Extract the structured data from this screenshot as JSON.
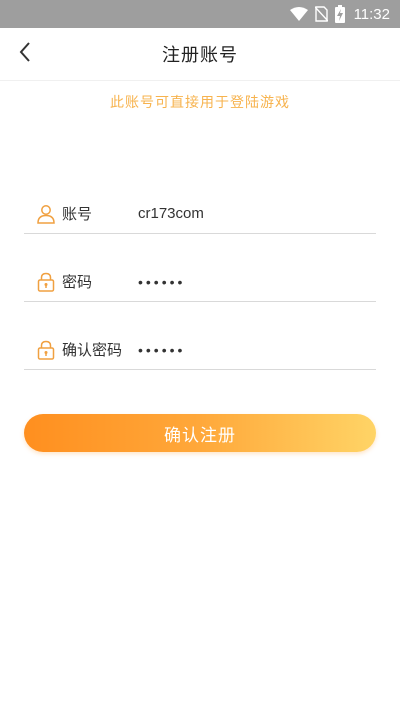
{
  "status_bar": {
    "time": "11:32",
    "icons": [
      "wifi-icon",
      "no-sim-icon",
      "battery-charging-icon"
    ]
  },
  "header": {
    "title": "注册账号",
    "back_icon": "chevron-left-icon"
  },
  "subtitle": "此账号可直接用于登陆游戏",
  "form": {
    "account": {
      "label": "账号",
      "value": "cr173com",
      "icon": "user-icon"
    },
    "password": {
      "label": "密码",
      "value": "••••••",
      "icon": "lock-icon"
    },
    "confirm_password": {
      "label": "确认密码",
      "value": "••••••",
      "icon": "lock-icon"
    }
  },
  "submit_label": "确认注册",
  "colors": {
    "accent": "#ff8f1f",
    "accent_end": "#ffd466",
    "subtitle": "#f7b34e",
    "status_bar": "#9e9e9e"
  }
}
